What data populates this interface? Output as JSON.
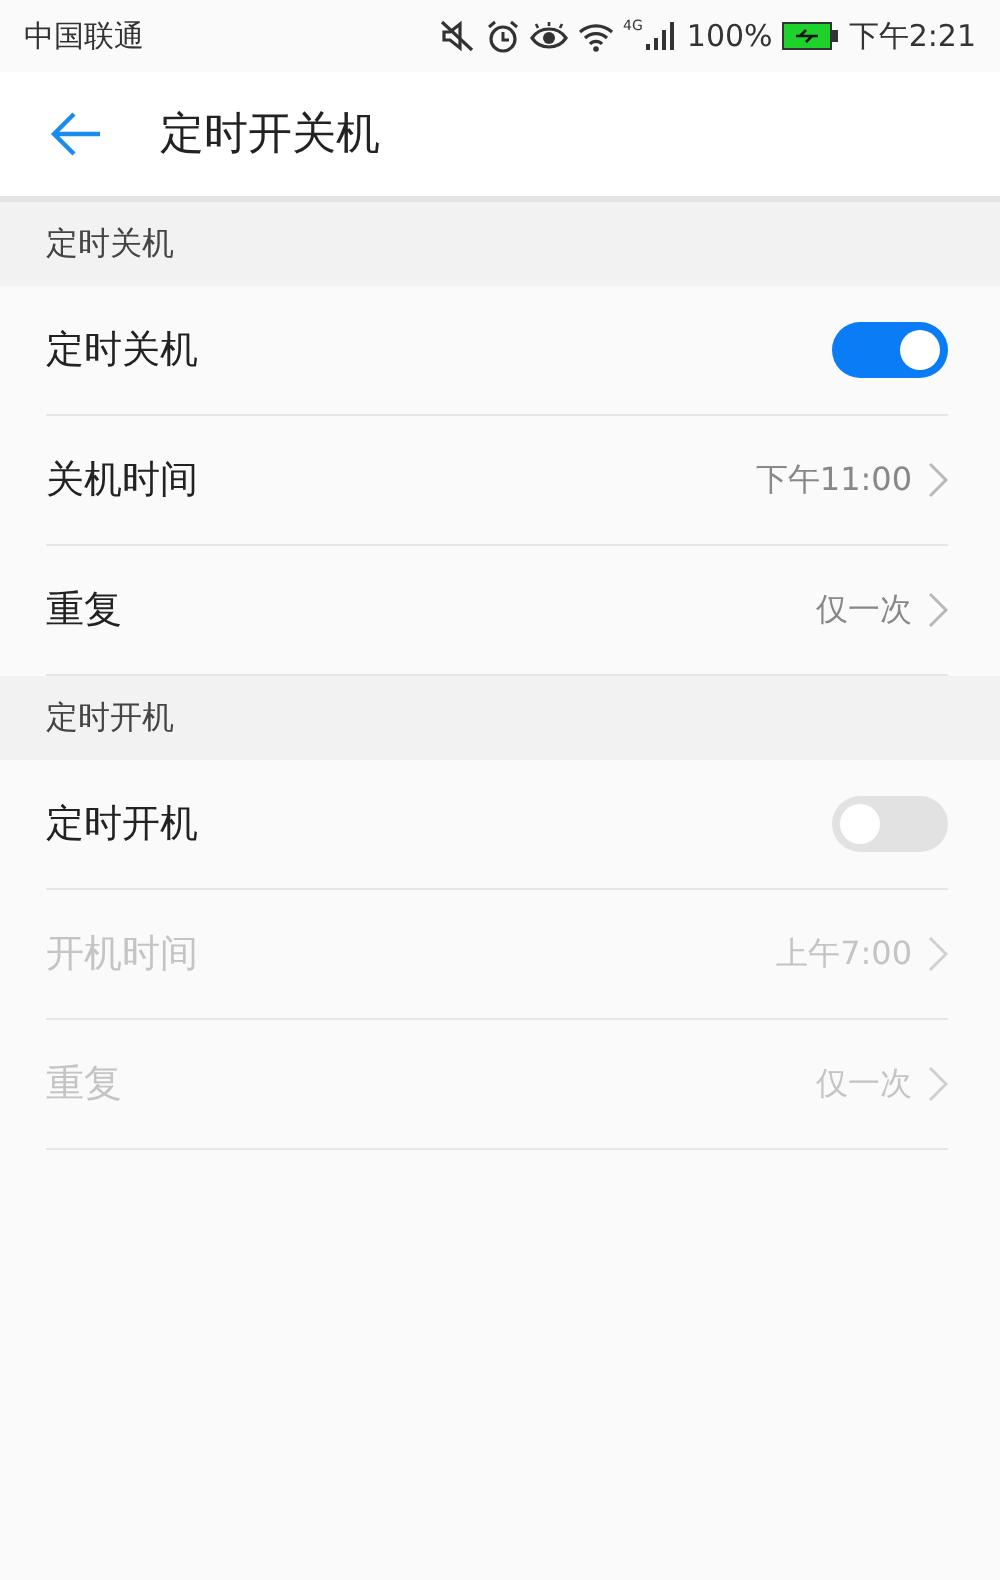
{
  "status_bar": {
    "carrier": "中国联通",
    "signal_type": "4G",
    "battery": "100%",
    "time": "下午2:21"
  },
  "header": {
    "title": "定时开关机"
  },
  "sections": [
    {
      "title": "定时关机",
      "rows": [
        {
          "kind": "switch",
          "label": "定时关机",
          "on": true,
          "disabled": false
        },
        {
          "kind": "link",
          "label": "关机时间",
          "value": "下午11:00",
          "disabled": false
        },
        {
          "kind": "link",
          "label": "重复",
          "value": "仅一次",
          "disabled": false
        }
      ]
    },
    {
      "title": "定时开机",
      "rows": [
        {
          "kind": "switch",
          "label": "定时开机",
          "on": false,
          "disabled": false
        },
        {
          "kind": "link",
          "label": "开机时间",
          "value": "上午7:00",
          "disabled": true
        },
        {
          "kind": "link",
          "label": "重复",
          "value": "仅一次",
          "disabled": true
        }
      ]
    }
  ]
}
